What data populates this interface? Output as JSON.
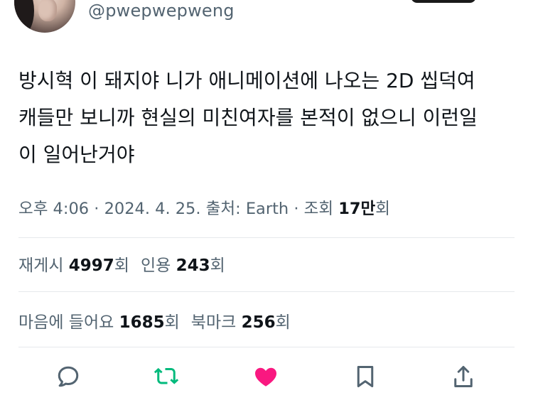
{
  "tweet": {
    "handle": "@pwepwepweng",
    "text": "방시혁 이 돼지야 니가 애니메이션에 나오는 2D 씹덕여\n캐들만 보니까 현실의 미친여자를 본적이 없으니 이런일\n이 일어난거야",
    "meta": {
      "time": "오후 4:06",
      "sep1": " · ",
      "date": "2024. 4. 25.",
      "source_label": " 출처: ",
      "source": "Earth",
      "sep2": " · ",
      "views_label": "조회 ",
      "views_value": "17만",
      "views_suffix": "회"
    }
  },
  "stats": {
    "reposts_label": "재게시 ",
    "reposts_value": "4997",
    "reposts_suffix": "회",
    "quotes_label": "인용 ",
    "quotes_value": "243",
    "quotes_suffix": "회",
    "likes_label": "마음에 들어요 ",
    "likes_value": "1685",
    "likes_suffix": "회",
    "bookmarks_label": "북마크 ",
    "bookmarks_value": "256",
    "bookmarks_suffix": "회"
  },
  "actions": [
    {
      "name": "reply",
      "icon": "reply-icon",
      "color": "#536471"
    },
    {
      "name": "retweet",
      "icon": "retweet-icon",
      "color": "#00ba7c"
    },
    {
      "name": "like",
      "icon": "heart-icon",
      "color": "#f91880",
      "active": true
    },
    {
      "name": "bookmark",
      "icon": "bookmark-icon",
      "color": "#536471"
    },
    {
      "name": "share",
      "icon": "share-icon",
      "color": "#536471"
    }
  ],
  "colors": {
    "text_primary": "#0f1419",
    "text_secondary": "#536471",
    "divider": "#e6e9ec",
    "retweet_green": "#00ba7c",
    "like_pink": "#f91880"
  }
}
